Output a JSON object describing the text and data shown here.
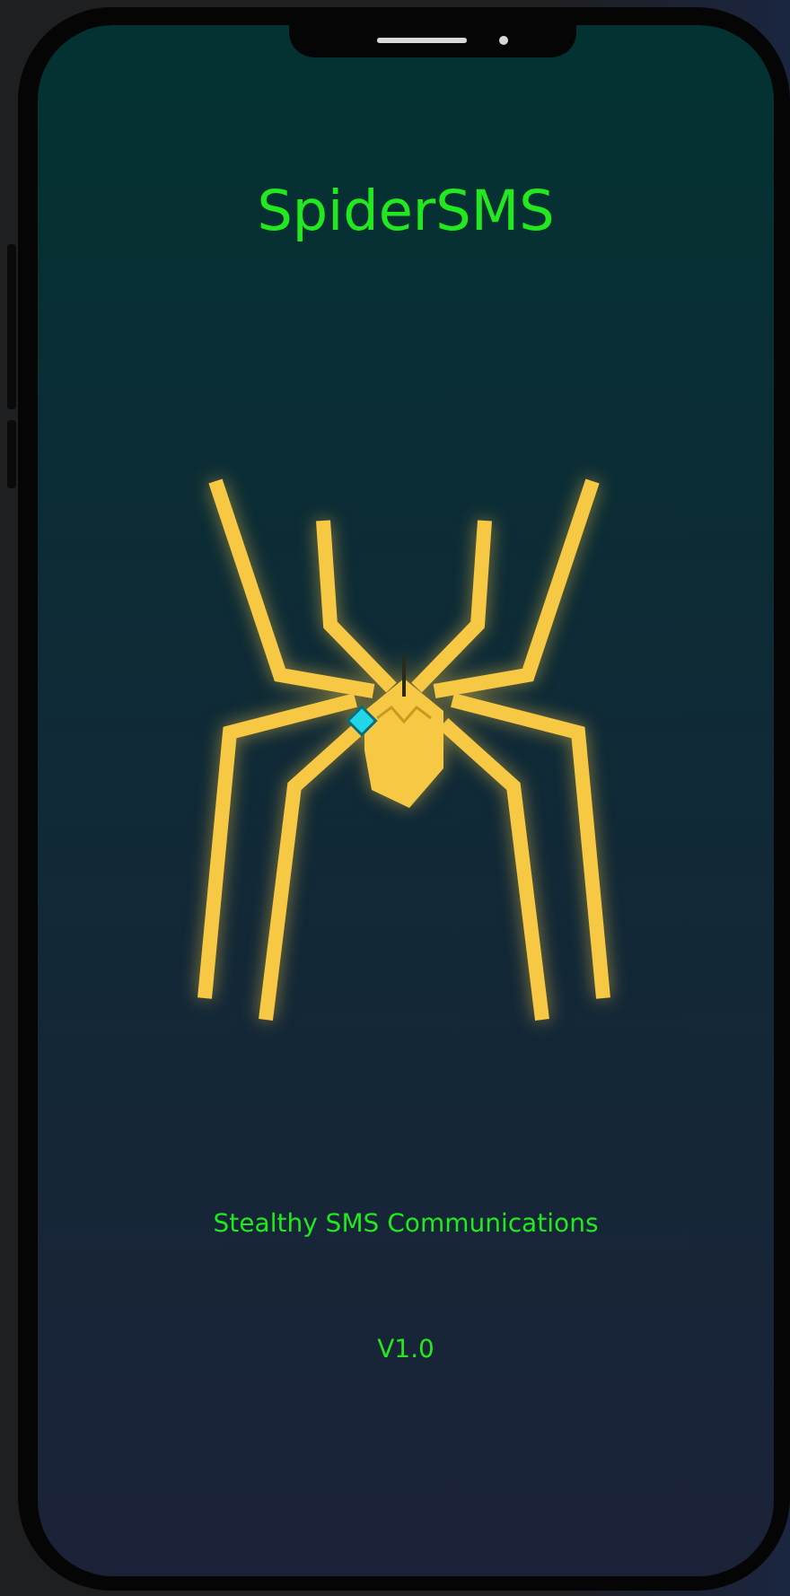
{
  "app": {
    "title": "SpiderSMS",
    "tagline": "Stealthy SMS Communications",
    "version": "V1.0"
  }
}
